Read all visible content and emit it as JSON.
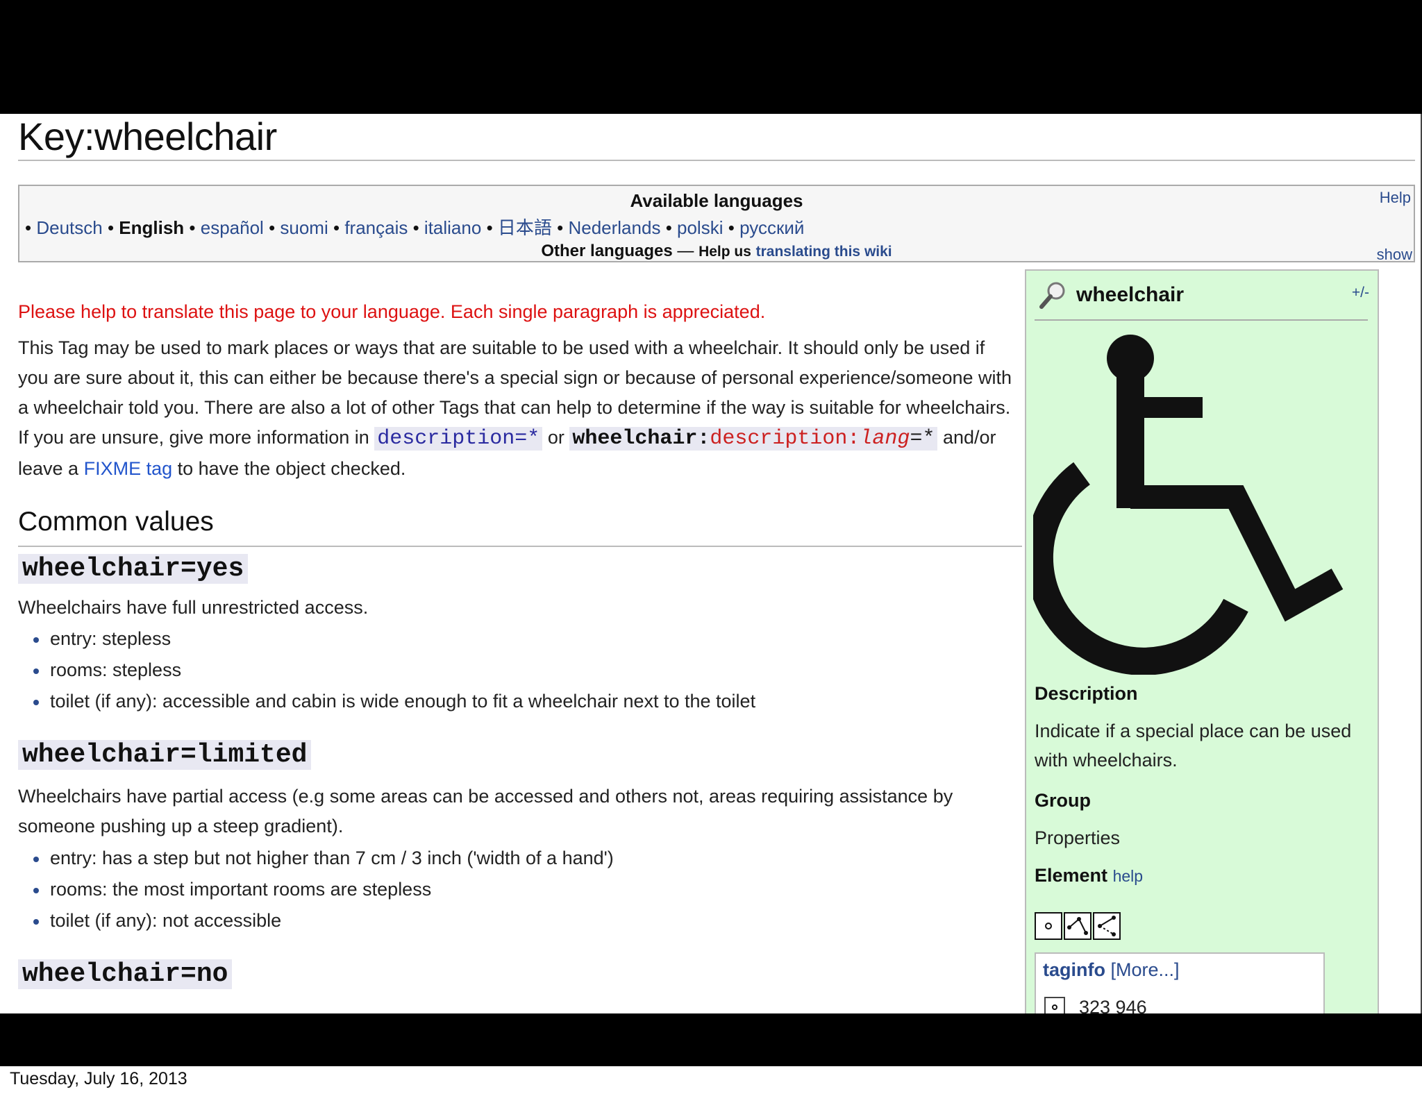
{
  "page": {
    "title": "Key:wheelchair",
    "footer_date": "Tuesday, July 16, 2013"
  },
  "languages": {
    "heading": "Available languages",
    "help": "Help",
    "items": [
      "Deutsch",
      "English",
      "español",
      "suomi",
      "français",
      "italiano",
      "日本語",
      "Nederlands",
      "polski",
      "русский"
    ],
    "current": "English",
    "other_label": "Other languages",
    "dash": "—",
    "help_us": "Help us",
    "translating_link": "translating this wiki",
    "show": "show"
  },
  "notice": "Please help to translate this page to your language. Each single paragraph is appreciated.",
  "intro": {
    "text1": "This Tag may be used to mark places or ways that are suitable to be used with a wheelchair. It should only be used if you are sure about it, this can either be because there's a special sign or because of personal experience/someone with a wheelchair told you. There are also a lot of other Tags that can help to determine if the way is suitable for wheelchairs. If you are unsure, give more information in ",
    "code1": "description=*",
    "text2": " or ",
    "code2_key": "wheelchair:",
    "code2_mid": "description:",
    "code2_lang": "lang",
    "code2_tail": "=*",
    "text3": " and/or leave a ",
    "link": "FIXME tag",
    "text4": " to have the object checked."
  },
  "common_values": {
    "heading": "Common values",
    "yes": {
      "tag": "wheelchair=yes",
      "desc": "Wheelchairs have full unrestricted access.",
      "bullets": [
        "entry: stepless",
        "rooms: stepless",
        "toilet (if any): accessible and cabin is wide enough to fit a wheelchair next to the toilet"
      ]
    },
    "limited": {
      "tag": "wheelchair=limited",
      "desc": "Wheelchairs have partial access (e.g some areas can be accessed and others not, areas requiring assistance by someone pushing up a steep gradient).",
      "bullets": [
        "entry: has a step but not higher than 7 cm / 3 inch ('width of a hand')",
        "rooms: the most important rooms are stepless",
        "toilet (if any): not accessible"
      ]
    },
    "no": {
      "tag": "wheelchair=no"
    }
  },
  "infobox": {
    "title": "wheelchair",
    "toggle": "+/-",
    "description_label": "Description",
    "description": "Indicate if a special place can be used with wheelchairs.",
    "group_label": "Group",
    "group": "Properties",
    "element_label": "Element",
    "element_help": "help",
    "taginfo_label": "taginfo",
    "taginfo_more": "[More...]",
    "taginfo_count": "323 946"
  }
}
